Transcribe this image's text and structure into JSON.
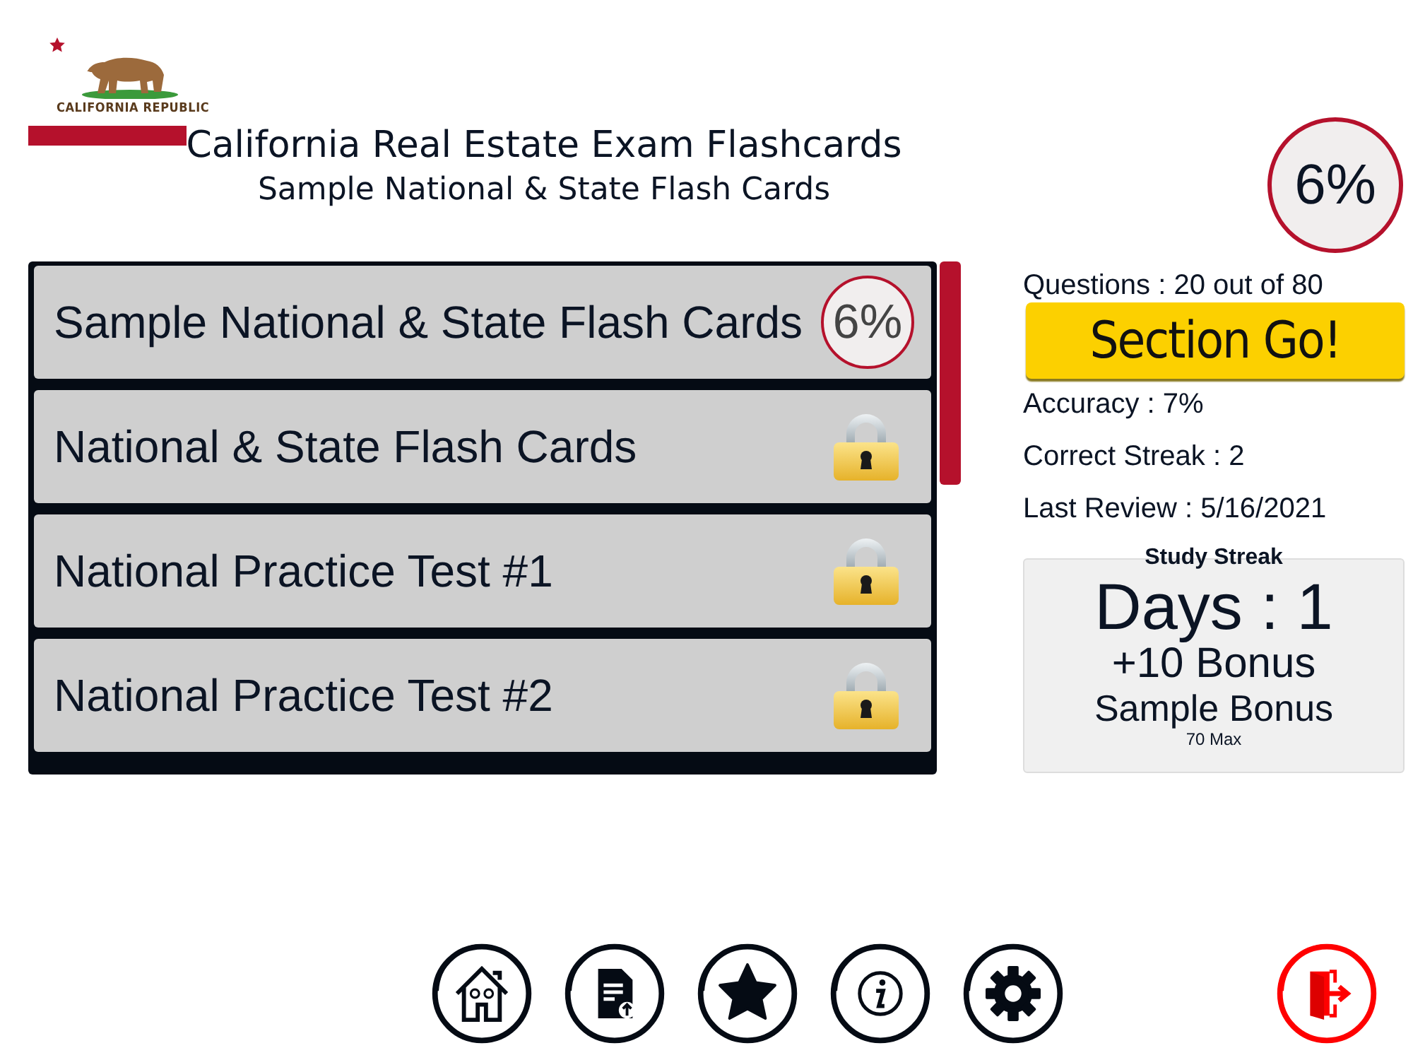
{
  "logo": {
    "text": "CALIFORNIA REPUBLIC"
  },
  "header": {
    "title": "California Real Estate Exam Flashcards",
    "subtitle": "Sample National & State Flash Cards",
    "progress_badge": "6%"
  },
  "decks": [
    {
      "kind": "progress",
      "label": "Sample National & State Flash Cards",
      "badge": "6%"
    },
    {
      "kind": "locked",
      "label": "National & State Flash Cards"
    },
    {
      "kind": "locked",
      "label": "National Practice Test #1"
    },
    {
      "kind": "locked",
      "label": "National Practice Test #2"
    }
  ],
  "stats": {
    "questions": "Questions : 20 out of 80",
    "button": "Section Go!",
    "accuracy": "Accuracy : 7%",
    "correct_streak": "Correct Streak : 2",
    "last_review": "Last Review : 5/16/2021"
  },
  "study_streak": {
    "title": "Study Streak",
    "days": "Days : 1",
    "bonus": "+10 Bonus",
    "bonus_name": "Sample Bonus",
    "max": "70 Max"
  },
  "nav": [
    {
      "kind": "home"
    },
    {
      "kind": "document"
    },
    {
      "kind": "star"
    },
    {
      "kind": "info"
    },
    {
      "kind": "settings"
    },
    {
      "kind": "exit"
    }
  ]
}
